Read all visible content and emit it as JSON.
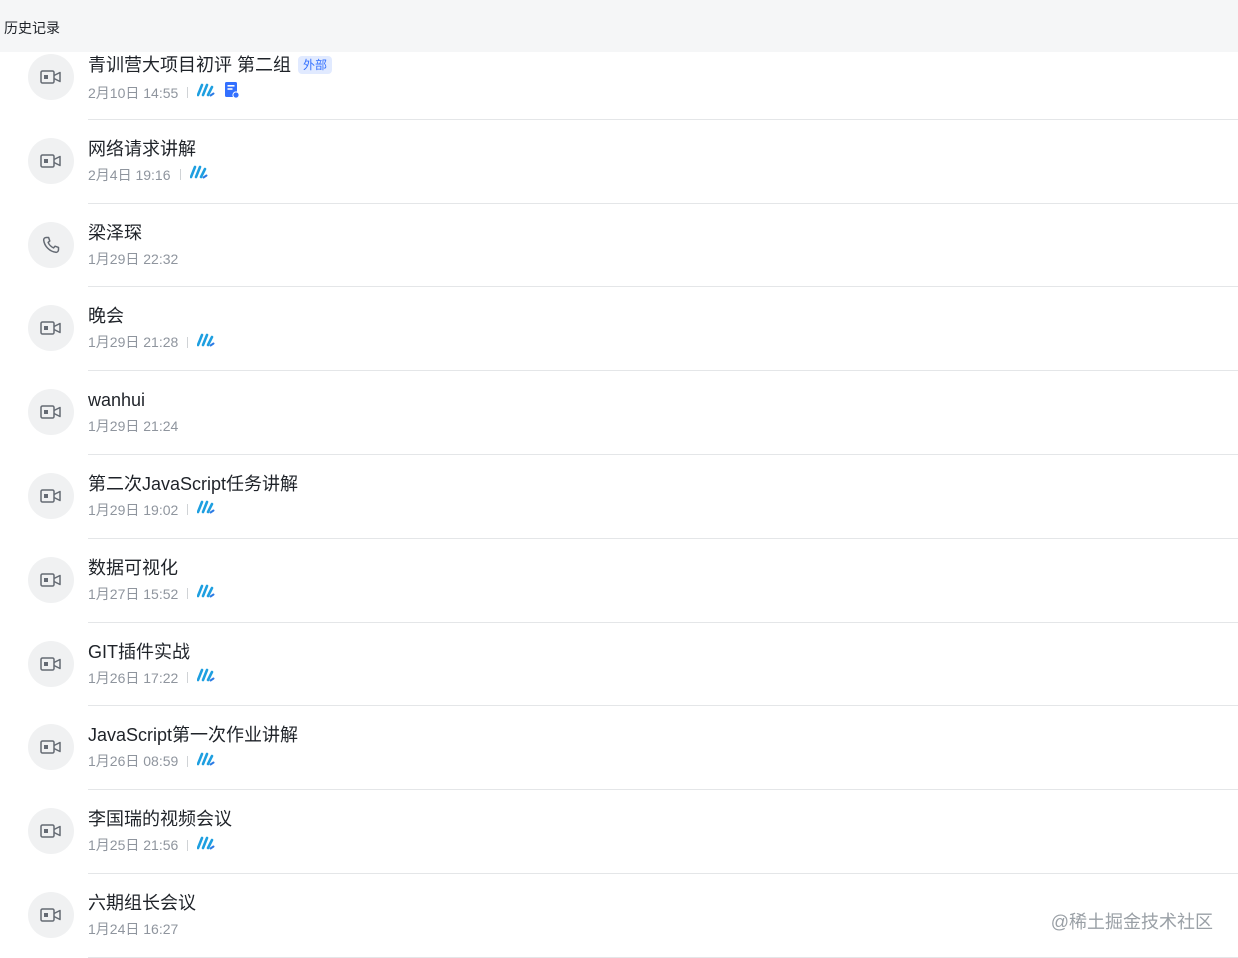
{
  "header": {
    "title": "历史记录"
  },
  "tag_external_label": "外部",
  "records": [
    {
      "title": "青训营大项目初评 第二组",
      "time": "2月10日 14:55",
      "type": "video",
      "tag": "外部",
      "has_recording": true,
      "has_doc": true
    },
    {
      "title": "网络请求讲解",
      "time": "2月4日 19:16",
      "type": "video",
      "tag": null,
      "has_recording": true,
      "has_doc": false
    },
    {
      "title": "梁泽琛",
      "time": "1月29日 22:32",
      "type": "phone",
      "tag": null,
      "has_recording": false,
      "has_doc": false
    },
    {
      "title": "晚会",
      "time": "1月29日 21:28",
      "type": "video",
      "tag": null,
      "has_recording": true,
      "has_doc": false
    },
    {
      "title": "wanhui",
      "time": "1月29日 21:24",
      "type": "video",
      "tag": null,
      "has_recording": false,
      "has_doc": false
    },
    {
      "title": "第二次JavaScript任务讲解",
      "time": "1月29日 19:02",
      "type": "video",
      "tag": null,
      "has_recording": true,
      "has_doc": false
    },
    {
      "title": "数据可视化",
      "time": "1月27日 15:52",
      "type": "video",
      "tag": null,
      "has_recording": true,
      "has_doc": false
    },
    {
      "title": "GIT插件实战",
      "time": "1月26日 17:22",
      "type": "video",
      "tag": null,
      "has_recording": true,
      "has_doc": false
    },
    {
      "title": "JavaScript第一次作业讲解",
      "time": "1月26日 08:59",
      "type": "video",
      "tag": null,
      "has_recording": true,
      "has_doc": false
    },
    {
      "title": "李国瑞的视频会议",
      "time": "1月25日 21:56",
      "type": "video",
      "tag": null,
      "has_recording": true,
      "has_doc": false
    },
    {
      "title": "六期组长会议",
      "time": "1月24日 16:27",
      "type": "video",
      "tag": null,
      "has_recording": false,
      "has_doc": false
    }
  ],
  "icons": {
    "video": "video-camera-icon",
    "phone": "phone-icon",
    "recording": "minutes-recording-icon",
    "doc": "meeting-doc-icon"
  },
  "colors": {
    "header_bg": "#f5f6f7",
    "avatar_bg": "#f0f1f2",
    "tag_bg": "#e1eaff",
    "tag_text": "#3370ff",
    "recording_icon": "#1e9fe0",
    "doc_icon": "#3370ff"
  },
  "watermark": "@稀土掘金技术社区"
}
